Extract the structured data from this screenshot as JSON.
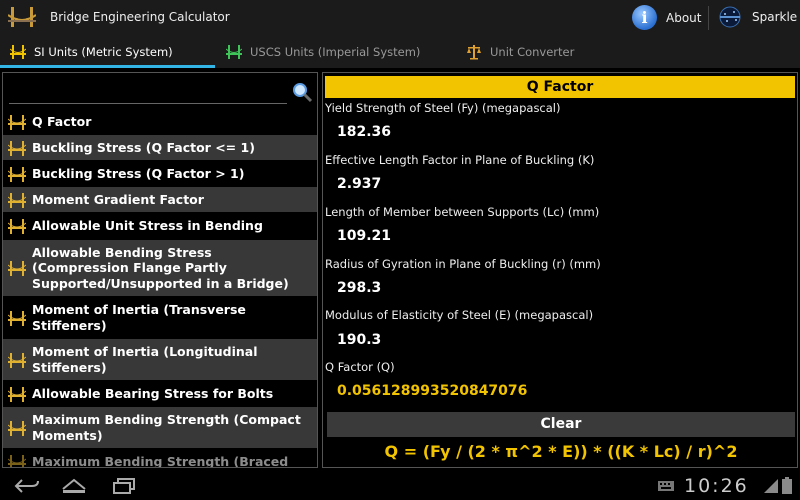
{
  "app": {
    "title": "Bridge Engineering Calculator",
    "icon": "bridge-icon"
  },
  "actions": {
    "about_label": "About",
    "about_icon": "info-icon",
    "sparkle_label": "Sparkle",
    "sparkle_icon": "sparkle-logo"
  },
  "tabs": [
    {
      "label": "SI Units (Metric System)",
      "icon": "bridge-icon",
      "selected": true
    },
    {
      "label": "USCS Units (Imperial System)",
      "icon": "bridge-icon",
      "selected": false
    },
    {
      "label": "Unit Converter",
      "icon": "scale-icon",
      "selected": false
    }
  ],
  "sidebar": {
    "search_placeholder": "",
    "items": [
      {
        "label": "Q Factor"
      },
      {
        "label": "Buckling Stress (Q Factor <= 1)"
      },
      {
        "label": "Buckling Stress (Q Factor > 1)"
      },
      {
        "label": "Moment Gradient Factor"
      },
      {
        "label": "Allowable Unit Stress in Bending"
      },
      {
        "label": "Allowable Bending Stress (Compression Flange Partly Supported/Unsupported in a Bridge)"
      },
      {
        "label": "Moment of Inertia (Transverse Stiffeners)"
      },
      {
        "label": "Moment of Inertia (Longitudinal Stiffeners)"
      },
      {
        "label": "Allowable Bearing Stress for Bolts"
      },
      {
        "label": "Maximum Bending Strength (Compact Moments)"
      },
      {
        "label": "Maximum Bending Strength (Braced"
      }
    ]
  },
  "calculator": {
    "title": "Q Factor",
    "fields": [
      {
        "label": "Yield Strength of Steel (Fy) (megapascal)",
        "value": "182.36"
      },
      {
        "label": "Effective Length Factor in Plane of Buckling (K)",
        "value": "2.937"
      },
      {
        "label": "Length of Member between Supports (Lc) (mm)",
        "value": "109.21"
      },
      {
        "label": "Radius of Gyration in Plane of Buckling (r) (mm)",
        "value": "298.3"
      },
      {
        "label": "Modulus of Elasticity of Steel (E) (megapascal)",
        "value": "190.3"
      }
    ],
    "result": {
      "label": "Q Factor (Q)",
      "value": "0.056128993520847076"
    },
    "clear_label": "Clear",
    "formula": "Q = (Fy / (2 * π^2 * E)) * ((K * Lc) / r)^2"
  },
  "system": {
    "clock": "10:26",
    "nav": [
      "back-icon",
      "home-icon",
      "recent-apps-icon"
    ]
  },
  "colors": {
    "accent": "#f2c400",
    "tab_underline": "#33b5e5",
    "row_alt": "#383838"
  }
}
